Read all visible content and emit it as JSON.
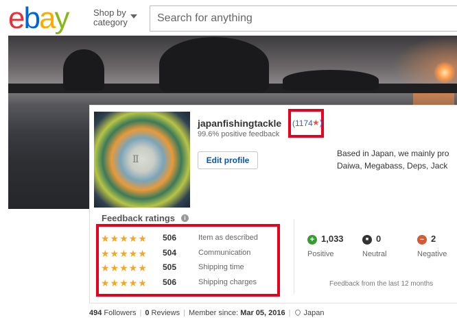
{
  "header": {
    "logo": {
      "e": "e",
      "b": "b",
      "a": "a",
      "y": "y"
    },
    "shop_by_line1": "Shop by",
    "shop_by_line2": "category",
    "search_placeholder": "Search for anything"
  },
  "profile": {
    "username": "japanfishingtackle",
    "score_open": "(",
    "score": "1174",
    "score_close": ")",
    "positive_feedback": "99.6% positive feedback",
    "edit_profile_label": "Edit profile",
    "about_line1": "Based in Japan, we mainly pro",
    "about_line2": "Daiwa, Megabass, Deps, Jack",
    "avatar_text": "Ⅱ"
  },
  "feedback_ratings": {
    "title": "Feedback ratings",
    "info_symbol": "i",
    "rows": [
      {
        "stars": "★★★★★",
        "rating": 5,
        "count": "506",
        "label": "Item as described"
      },
      {
        "stars": "★★★★★",
        "rating": 5,
        "count": "504",
        "label": "Communication"
      },
      {
        "stars": "★★★★★",
        "rating": 5,
        "count": "505",
        "label": "Shipping time"
      },
      {
        "stars": "★★★★★",
        "rating": 5,
        "count": "506",
        "label": "Shipping charges"
      }
    ]
  },
  "feedback_summary": {
    "positive": {
      "symbol": "+",
      "count": "1,033",
      "label": "Positive",
      "color": "#3a9b35"
    },
    "neutral": {
      "symbol": "■",
      "count": "0",
      "label": "Neutral",
      "color": "#333333"
    },
    "negative": {
      "symbol": "−",
      "count": "2",
      "label": "Negative",
      "color": "#d05a3a"
    },
    "period_note": "Feedback from the last 12 months"
  },
  "footer": {
    "followers_count": "494",
    "followers_label": "Followers",
    "reviews_count": "0",
    "reviews_label": "Reviews",
    "member_since_label": "Member since:",
    "member_since_date": "Mar 05, 2016",
    "location": "Japan"
  },
  "colors": {
    "highlight_red": "#e8001f",
    "link_blue": "#3665b3",
    "star_orange": "#f5a623"
  }
}
